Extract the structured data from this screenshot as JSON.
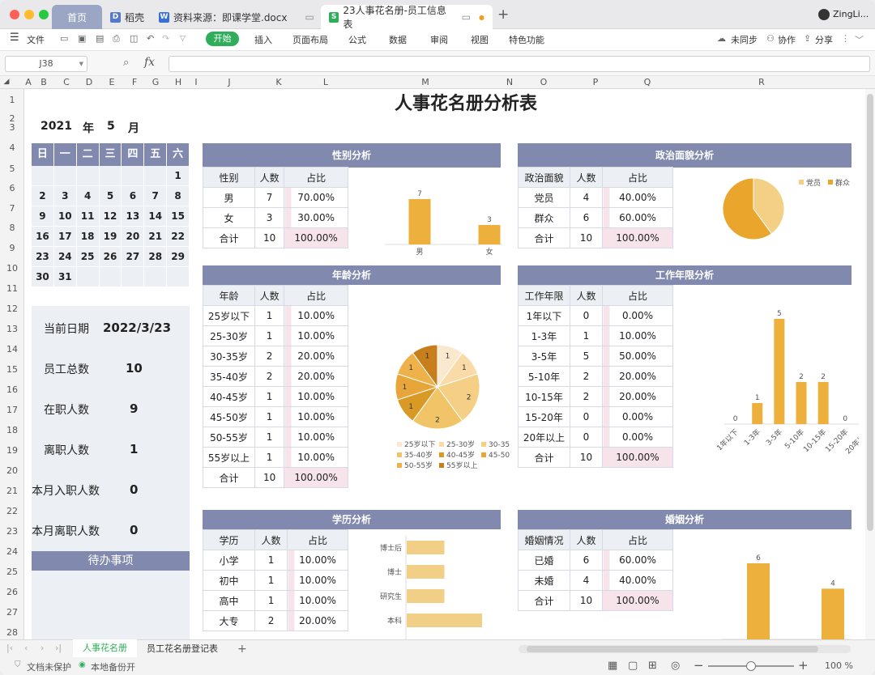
{
  "window": {
    "tabs": [
      {
        "label": "首页"
      },
      {
        "label": "稻壳"
      },
      {
        "label": "资料来源：即课学堂.docx"
      },
      {
        "label": "23人事花名册-员工信息表"
      }
    ],
    "user": "ZingLi..."
  },
  "menu": {
    "file": "文件",
    "items": [
      "开始",
      "插入",
      "页面布局",
      "公式",
      "数据",
      "审阅",
      "视图",
      "特色功能"
    ],
    "sync": "未同步",
    "collab": "协作",
    "share": "分享"
  },
  "formula": {
    "cell_ref": "J38",
    "fx": "fx",
    "value": ""
  },
  "columns": [
    "A",
    "B",
    "C",
    "D",
    "E",
    "F",
    "G",
    "H",
    "I",
    "J",
    "K",
    "L",
    "M",
    "N",
    "O",
    "P",
    "Q",
    "R"
  ],
  "rows": [
    "1",
    "2",
    "3",
    "4",
    "5",
    "6",
    "7",
    "8",
    "9",
    "10",
    "11",
    "12",
    "13",
    "14",
    "15",
    "16",
    "17",
    "18",
    "19",
    "20",
    "21",
    "22",
    "23",
    "24",
    "25",
    "26",
    "27",
    "28"
  ],
  "sheet": {
    "title": "人事花名册分析表",
    "year": "2021",
    "year_unit": "年",
    "month": "5",
    "month_unit": "月",
    "weekdays": [
      "日",
      "一",
      "二",
      "三",
      "四",
      "五",
      "六"
    ],
    "calendar": [
      [
        "",
        "",
        "",
        "",
        "",
        "",
        "1"
      ],
      [
        "2",
        "3",
        "4",
        "5",
        "6",
        "7",
        "8"
      ],
      [
        "9",
        "10",
        "11",
        "12",
        "13",
        "14",
        "15"
      ],
      [
        "16",
        "17",
        "18",
        "19",
        "20",
        "21",
        "22"
      ],
      [
        "23",
        "24",
        "25",
        "26",
        "27",
        "28",
        "29"
      ],
      [
        "30",
        "31",
        "",
        "",
        "",
        "",
        ""
      ]
    ],
    "stats": [
      {
        "label": "当前日期",
        "value": "2022/3/23"
      },
      {
        "label": "员工总数",
        "value": "10"
      },
      {
        "label": "在职人数",
        "value": "9"
      },
      {
        "label": "离职人数",
        "value": "1"
      },
      {
        "label": "本月入职人数",
        "value": "0"
      },
      {
        "label": "本月离职人数",
        "value": "0"
      }
    ],
    "todo": "待办事项",
    "gender": {
      "title": "性别分析",
      "header": [
        "性别",
        "人数",
        "占比"
      ],
      "rows": [
        [
          "男",
          "7",
          "70.00%"
        ],
        [
          "女",
          "3",
          "30.00%"
        ],
        [
          "合计",
          "10",
          "100.00%"
        ]
      ]
    },
    "politics": {
      "title": "政治面貌分析",
      "header": [
        "政治面貌",
        "人数",
        "占比"
      ],
      "rows": [
        [
          "党员",
          "4",
          "40.00%"
        ],
        [
          "群众",
          "6",
          "60.00%"
        ],
        [
          "合计",
          "10",
          "100.00%"
        ]
      ]
    },
    "age": {
      "title": "年龄分析",
      "header": [
        "年龄",
        "人数",
        "占比"
      ],
      "rows": [
        [
          "25岁以下",
          "1",
          "10.00%"
        ],
        [
          "25-30岁",
          "1",
          "10.00%"
        ],
        [
          "30-35岁",
          "2",
          "20.00%"
        ],
        [
          "35-40岁",
          "2",
          "20.00%"
        ],
        [
          "40-45岁",
          "1",
          "10.00%"
        ],
        [
          "45-50岁",
          "1",
          "10.00%"
        ],
        [
          "50-55岁",
          "1",
          "10.00%"
        ],
        [
          "55岁以上",
          "1",
          "10.00%"
        ],
        [
          "合计",
          "10",
          "100.00%"
        ]
      ]
    },
    "tenure": {
      "title": "工作年限分析",
      "header": [
        "工作年限",
        "人数",
        "占比"
      ],
      "rows": [
        [
          "1年以下",
          "0",
          "0.00%"
        ],
        [
          "1-3年",
          "1",
          "10.00%"
        ],
        [
          "3-5年",
          "5",
          "50.00%"
        ],
        [
          "5-10年",
          "2",
          "20.00%"
        ],
        [
          "10-15年",
          "2",
          "20.00%"
        ],
        [
          "15-20年",
          "0",
          "0.00%"
        ],
        [
          "20年以上",
          "0",
          "0.00%"
        ],
        [
          "合计",
          "10",
          "100.00%"
        ]
      ]
    },
    "education": {
      "title": "学历分析",
      "header": [
        "学历",
        "人数",
        "占比"
      ],
      "rows": [
        [
          "小学",
          "1",
          "10.00%"
        ],
        [
          "初中",
          "1",
          "10.00%"
        ],
        [
          "高中",
          "1",
          "10.00%"
        ],
        [
          "大专",
          "2",
          "20.00%"
        ]
      ]
    },
    "marriage": {
      "title": "婚姻分析",
      "header": [
        "婚姻情况",
        "人数",
        "占比"
      ],
      "rows": [
        [
          "已婚",
          "6",
          "60.00%"
        ],
        [
          "未婚",
          "4",
          "40.00%"
        ],
        [
          "合计",
          "10",
          "100.00%"
        ]
      ]
    }
  },
  "sheet_tabs": [
    "人事花名册",
    "员工花名册登记表"
  ],
  "status": {
    "protect": "文档未保护",
    "backup": "本地备份开",
    "zoom": "100 %"
  },
  "colors": {
    "header": "#818aae",
    "bar": "#edb03d",
    "bar_light": "#f2cf87",
    "accent": "#2fae5a"
  },
  "chart_data": [
    {
      "type": "bar",
      "categories": [
        "男",
        "女"
      ],
      "values": [
        7,
        3
      ]
    },
    {
      "type": "pie",
      "categories": [
        "党员",
        "群众"
      ],
      "values": [
        4,
        6
      ]
    },
    {
      "type": "pie",
      "categories": [
        "25岁以下",
        "25-30岁",
        "30-35岁",
        "35-40岁",
        "40-45岁",
        "45-50岁",
        "50-55岁",
        "55岁以上"
      ],
      "values": [
        1,
        1,
        2,
        2,
        1,
        1,
        1,
        1
      ]
    },
    {
      "type": "bar",
      "categories": [
        "1年以下",
        "1-3年",
        "3-5年",
        "5-10年",
        "10-15年",
        "15-20年",
        "20年以上"
      ],
      "values": [
        0,
        1,
        5,
        2,
        2,
        0,
        0
      ]
    },
    {
      "type": "bar",
      "orientation": "horizontal",
      "categories": [
        "博士后",
        "博士",
        "研究生",
        "本科"
      ],
      "values": [
        1,
        1,
        1,
        2
      ]
    },
    {
      "type": "bar",
      "categories": [
        "已婚",
        "未婚"
      ],
      "values": [
        6,
        4
      ]
    }
  ]
}
